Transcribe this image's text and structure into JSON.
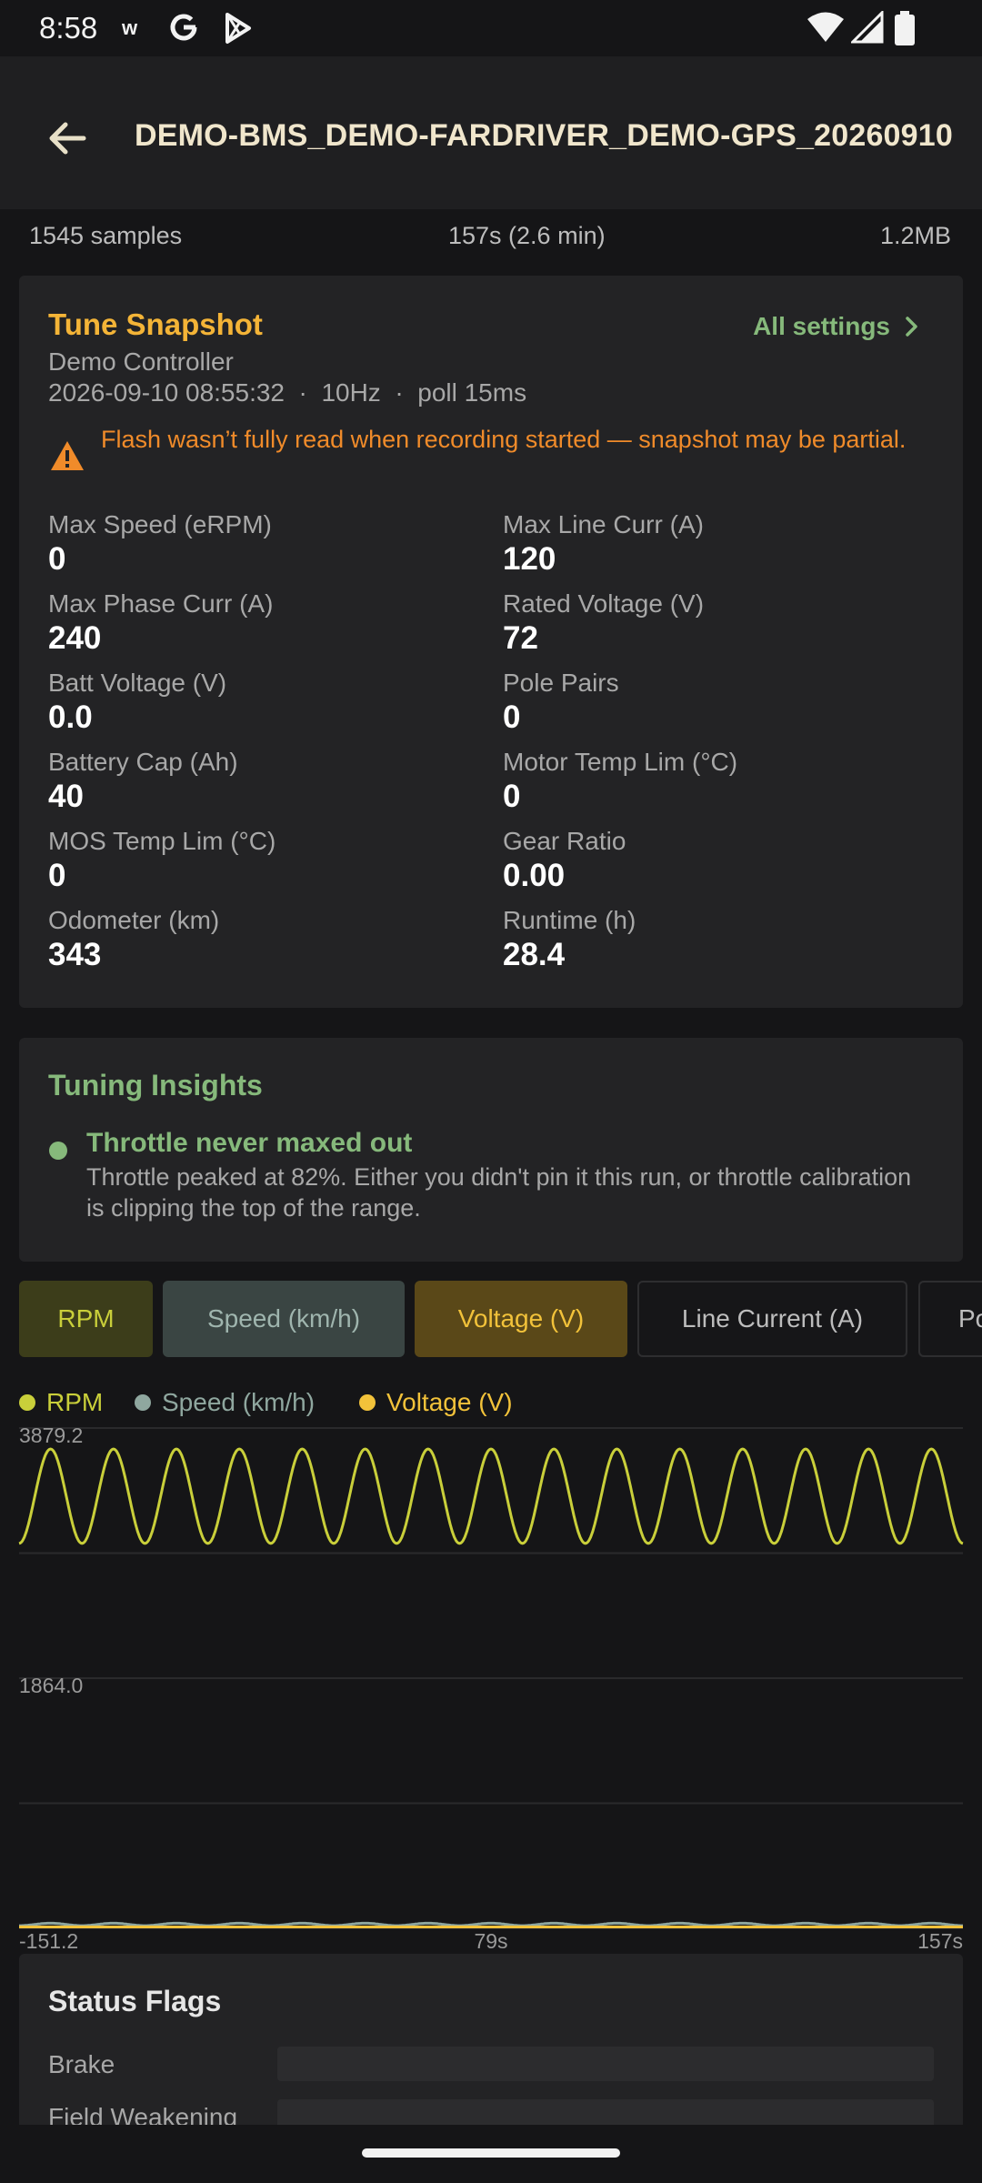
{
  "status_bar": {
    "time": "8:58",
    "notif_letter": "w",
    "icons": [
      "google-g-icon",
      "play-store-icon",
      "wifi-icon",
      "cell-signal-icon",
      "battery-icon"
    ]
  },
  "app_bar": {
    "title": "DEMO-BMS_DEMO-FARDRIVER_DEMO-GPS_20260910",
    "back_icon": "arrow-back-icon"
  },
  "summary": {
    "samples": "1545 samples",
    "duration": "157s (2.6 min)",
    "size": "1.2MB"
  },
  "tune_snapshot": {
    "title": "Tune Snapshot",
    "all_settings": "All settings",
    "controller": "Demo Controller",
    "meta": "2026-09-10 08:55:32  ·  10Hz  ·  poll 15ms",
    "warning": "Flash wasn’t fully read when recording started — snapshot may be partial.",
    "fields": [
      {
        "label": "Max Speed (eRPM)",
        "value": "0"
      },
      {
        "label": "Max Line Curr (A)",
        "value": "120"
      },
      {
        "label": "Max Phase Curr (A)",
        "value": "240"
      },
      {
        "label": "Rated Voltage (V)",
        "value": "72"
      },
      {
        "label": "Batt Voltage (V)",
        "value": "0.0"
      },
      {
        "label": "Pole Pairs",
        "value": "0"
      },
      {
        "label": "Battery Cap (Ah)",
        "value": "40"
      },
      {
        "label": "Motor Temp Lim (°C)",
        "value": "0"
      },
      {
        "label": "MOS Temp Lim (°C)",
        "value": "0"
      },
      {
        "label": "Gear Ratio",
        "value": "0.00"
      },
      {
        "label": "Odometer (km)",
        "value": "343"
      },
      {
        "label": "Runtime (h)",
        "value": "28.4"
      }
    ]
  },
  "insights": {
    "title": "Tuning Insights",
    "items": [
      {
        "title": "Throttle never maxed out",
        "desc": "Throttle peaked at 82%. Either you didn't pin it this run, or throttle calibration is clipping the top of the range."
      }
    ]
  },
  "chips": [
    {
      "label": "RPM",
      "selected": true,
      "bg": "#3c3d1a",
      "fg": "#c9cf3a"
    },
    {
      "label": "Speed (km/h)",
      "selected": true,
      "bg": "#3a4543",
      "fg": "#9fb5ae"
    },
    {
      "label": "Voltage (V)",
      "selected": true,
      "bg": "#5a4818",
      "fg": "#f2c23a"
    },
    {
      "label": "Line Current (A)",
      "selected": false,
      "bg": "#161618",
      "fg": "#bdbdbd"
    },
    {
      "label": "Po",
      "selected": false,
      "bg": "#161618",
      "fg": "#bdbdbd"
    }
  ],
  "chart_data": {
    "type": "line",
    "legend": [
      {
        "name": "RPM",
        "color": "#c9cf3a"
      },
      {
        "name": "Speed (km/h)",
        "color": "#8fa79f"
      },
      {
        "name": "Voltage (V)",
        "color": "#f2c23a"
      }
    ],
    "y_ticks": [
      "3879.2",
      "1864.0",
      "-151.2"
    ],
    "x_ticks": [
      "79s",
      "157s"
    ],
    "ylim": [
      -151.2,
      3879.2
    ],
    "xlim": [
      0,
      157
    ],
    "grid": true,
    "series": [
      {
        "name": "RPM",
        "color": "#c9cf3a",
        "shape": "sine",
        "center": 3330,
        "amplitude": 380,
        "cycles": 15
      },
      {
        "name": "Speed (km/h)",
        "color": "#8fa79f",
        "shape": "sine",
        "center": -120,
        "amplitude": 10,
        "cycles": 15
      },
      {
        "name": "Voltage (V)",
        "color": "#f2c23a",
        "shape": "flat",
        "value": -140
      }
    ]
  },
  "status_flags": {
    "title": "Status Flags",
    "items": [
      {
        "label": "Brake",
        "level": 0
      },
      {
        "label": "Field Weakening",
        "level": 0
      }
    ]
  }
}
